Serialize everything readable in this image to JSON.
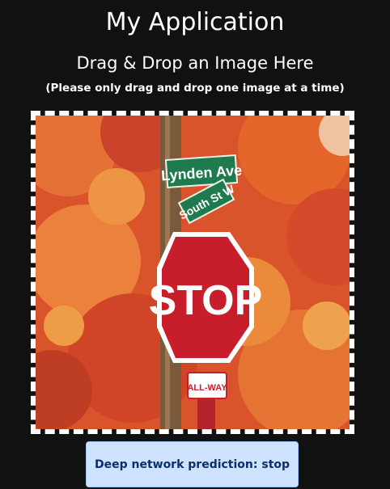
{
  "app": {
    "title": "My Application",
    "subtitle": "Drag & Drop an Image Here",
    "hint": "(Please only drag and drop one image at a time)"
  },
  "image": {
    "sign_text": "STOP",
    "street_sign_1": "Lynden Ave",
    "street_sign_2": "South St W",
    "all_way": "ALL-WAY",
    "colors": {
      "foliage": "#e05a2a",
      "sign_red": "#c81e2b",
      "street_green": "#1f7a4d",
      "pole": "#7a5a3a"
    }
  },
  "prediction": {
    "label": "Deep network prediction: stop"
  }
}
